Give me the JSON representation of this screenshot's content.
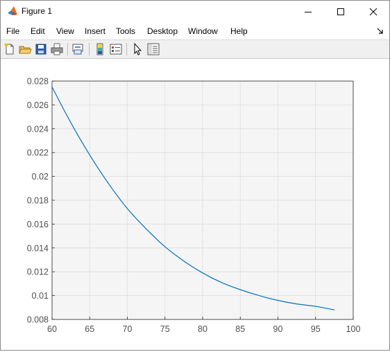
{
  "window": {
    "title": "Figure 1"
  },
  "menu": {
    "file": "File",
    "edit": "Edit",
    "view": "View",
    "insert": "Insert",
    "tools": "Tools",
    "desktop": "Desktop",
    "window": "Window",
    "help": "Help"
  },
  "toolbar": {
    "icons": [
      "new-figure-icon",
      "open-file-icon",
      "save-icon",
      "print-icon",
      "link-plot-icon",
      "colorbar-icon",
      "legend-icon",
      "pointer-icon",
      "property-inspector-icon"
    ]
  },
  "colors": {
    "line": "#0072bd",
    "axes_background": "#f5f5f5",
    "grid": "#dcdcdc",
    "tick_text": "#4d4d4d"
  },
  "chart_data": {
    "type": "line",
    "title": "",
    "xlabel": "",
    "ylabel": "",
    "xlim": [
      60,
      100
    ],
    "ylim": [
      0.008,
      0.028
    ],
    "grid": true,
    "xticks": [
      "60",
      "65",
      "70",
      "75",
      "80",
      "85",
      "90",
      "95",
      "100"
    ],
    "yticks": [
      "0.008",
      "0.01",
      "0.012",
      "0.014",
      "0.016",
      "0.018",
      "0.02",
      "0.022",
      "0.024",
      "0.026",
      "0.028"
    ],
    "series": [
      {
        "x": [
          60,
          62.5,
          65,
          67.5,
          70,
          72.5,
          75,
          77.5,
          80,
          82.5,
          85,
          87.5,
          90,
          92.5,
          95,
          97.5
        ],
        "y": [
          0.0275,
          0.0245,
          0.0218,
          0.0194,
          0.0173,
          0.0156,
          0.0141,
          0.0129,
          0.0119,
          0.0111,
          0.0105,
          0.01,
          0.0096,
          0.0093,
          0.0091,
          0.0088
        ]
      }
    ]
  }
}
